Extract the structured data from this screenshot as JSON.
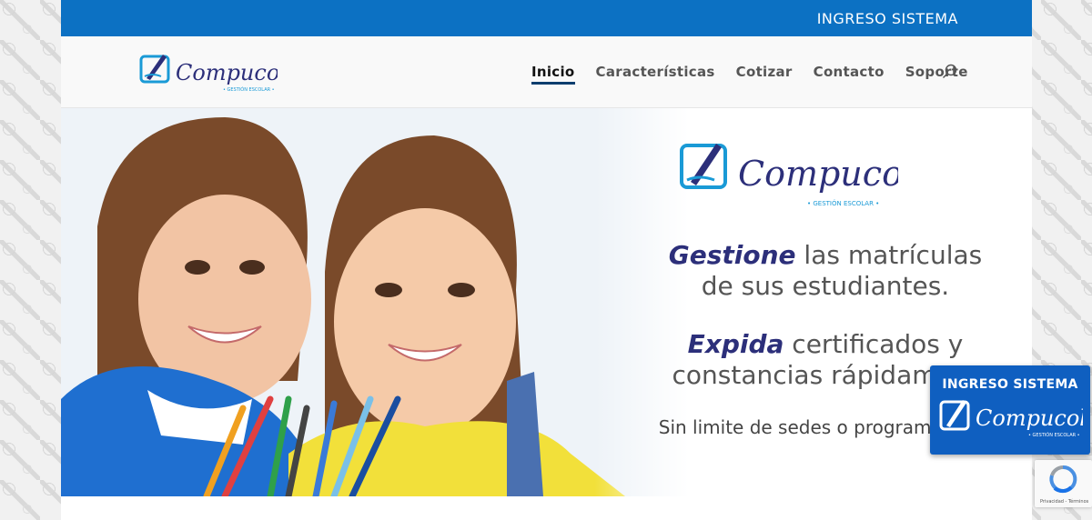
{
  "topbar": {
    "link_label": "INGRESO SISTEMA"
  },
  "header": {
    "logo": {
      "brand": "Compucol",
      "tagline": "• GESTIÓN ESCOLAR •"
    },
    "nav": [
      {
        "label": "Inicio",
        "active": true
      },
      {
        "label": "Características",
        "active": false
      },
      {
        "label": "Cotizar",
        "active": false
      },
      {
        "label": "Contacto",
        "active": false
      },
      {
        "label": "Soporte",
        "active": false
      }
    ],
    "search_icon": "search-icon"
  },
  "hero": {
    "logo": {
      "brand": "Compucol",
      "tagline": "• GESTIÓN ESCOLAR •"
    },
    "line1_emph": "Gestione",
    "line1_rest": " las matrículas",
    "line2": "de sus estudiantes.",
    "line3_emph": "Expida",
    "line3_rest": " certificados y",
    "line4": "constancias rápidament",
    "line5": "Sin limite de sedes o programas edu"
  },
  "float_widget": {
    "title": "INGRESO SISTEMA",
    "brand": "Compucol",
    "tagline": "• GESTIÓN ESCOLAR •"
  },
  "recaptcha": {
    "text": "Privacidad - Términos"
  },
  "colors": {
    "topbar": "#0c71c3",
    "brand_navy": "#2c2f7a",
    "brand_blue": "#1a9ad6",
    "widget": "#0f5fc0"
  }
}
